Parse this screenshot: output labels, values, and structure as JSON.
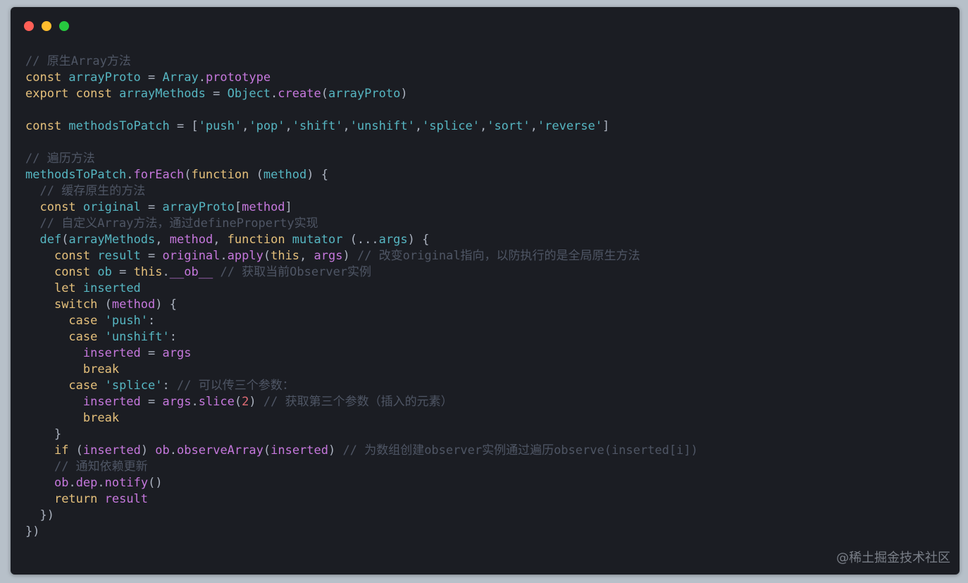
{
  "window": {
    "controls": [
      "close",
      "minimize",
      "maximize"
    ]
  },
  "watermark": "@稀土掘金技术社区",
  "code_lines": [
    [
      {
        "t": "// 原生Array方法",
        "c": "comment"
      }
    ],
    [
      {
        "t": "const ",
        "c": "keyword"
      },
      {
        "t": "arrayProto",
        "c": "var"
      },
      {
        "t": " = ",
        "c": "punct"
      },
      {
        "t": "Array",
        "c": "var"
      },
      {
        "t": ".",
        "c": "punct"
      },
      {
        "t": "prototype",
        "c": "fn"
      }
    ],
    [
      {
        "t": "export ",
        "c": "keyword"
      },
      {
        "t": "const ",
        "c": "keyword"
      },
      {
        "t": "arrayMethods",
        "c": "var"
      },
      {
        "t": " = ",
        "c": "punct"
      },
      {
        "t": "Object",
        "c": "var"
      },
      {
        "t": ".",
        "c": "punct"
      },
      {
        "t": "create",
        "c": "fn"
      },
      {
        "t": "(",
        "c": "punct"
      },
      {
        "t": "arrayProto",
        "c": "var"
      },
      {
        "t": ")",
        "c": "punct"
      }
    ],
    [],
    [
      {
        "t": "const ",
        "c": "keyword"
      },
      {
        "t": "methodsToPatch",
        "c": "var"
      },
      {
        "t": " = [",
        "c": "punct"
      },
      {
        "t": "'push'",
        "c": "string"
      },
      {
        "t": ",",
        "c": "punct"
      },
      {
        "t": "'pop'",
        "c": "string"
      },
      {
        "t": ",",
        "c": "punct"
      },
      {
        "t": "'shift'",
        "c": "string"
      },
      {
        "t": ",",
        "c": "punct"
      },
      {
        "t": "'unshift'",
        "c": "string"
      },
      {
        "t": ",",
        "c": "punct"
      },
      {
        "t": "'splice'",
        "c": "string"
      },
      {
        "t": ",",
        "c": "punct"
      },
      {
        "t": "'sort'",
        "c": "string"
      },
      {
        "t": ",",
        "c": "punct"
      },
      {
        "t": "'reverse'",
        "c": "string"
      },
      {
        "t": "]",
        "c": "punct"
      }
    ],
    [],
    [
      {
        "t": "// 遍历方法",
        "c": "comment"
      }
    ],
    [
      {
        "t": "methodsToPatch",
        "c": "var"
      },
      {
        "t": ".",
        "c": "punct"
      },
      {
        "t": "forEach",
        "c": "fn"
      },
      {
        "t": "(",
        "c": "punct"
      },
      {
        "t": "function ",
        "c": "keyword"
      },
      {
        "t": "(",
        "c": "punct"
      },
      {
        "t": "method",
        "c": "var"
      },
      {
        "t": ") {",
        "c": "punct"
      }
    ],
    [
      {
        "t": "  ",
        "c": "punct"
      },
      {
        "t": "// 缓存原生的方法",
        "c": "comment"
      }
    ],
    [
      {
        "t": "  ",
        "c": "punct"
      },
      {
        "t": "const ",
        "c": "keyword"
      },
      {
        "t": "original",
        "c": "var"
      },
      {
        "t": " = ",
        "c": "punct"
      },
      {
        "t": "arrayProto",
        "c": "var"
      },
      {
        "t": "[",
        "c": "punct"
      },
      {
        "t": "method",
        "c": "param"
      },
      {
        "t": "]",
        "c": "punct"
      }
    ],
    [
      {
        "t": "  ",
        "c": "punct"
      },
      {
        "t": "// 自定义Array方法，通过defineProperty实现",
        "c": "comment"
      }
    ],
    [
      {
        "t": "  ",
        "c": "punct"
      },
      {
        "t": "def",
        "c": "var"
      },
      {
        "t": "(",
        "c": "punct"
      },
      {
        "t": "arrayMethods",
        "c": "var"
      },
      {
        "t": ", ",
        "c": "punct"
      },
      {
        "t": "method",
        "c": "param"
      },
      {
        "t": ", ",
        "c": "punct"
      },
      {
        "t": "function ",
        "c": "keyword"
      },
      {
        "t": "mutator",
        "c": "var"
      },
      {
        "t": " (...",
        "c": "punct"
      },
      {
        "t": "args",
        "c": "var"
      },
      {
        "t": ") {",
        "c": "punct"
      }
    ],
    [
      {
        "t": "    ",
        "c": "punct"
      },
      {
        "t": "const ",
        "c": "keyword"
      },
      {
        "t": "result",
        "c": "var"
      },
      {
        "t": " = ",
        "c": "punct"
      },
      {
        "t": "original",
        "c": "param"
      },
      {
        "t": ".",
        "c": "punct"
      },
      {
        "t": "apply",
        "c": "fn"
      },
      {
        "t": "(",
        "c": "punct"
      },
      {
        "t": "this",
        "c": "keyword"
      },
      {
        "t": ", ",
        "c": "punct"
      },
      {
        "t": "args",
        "c": "param"
      },
      {
        "t": ") ",
        "c": "punct"
      },
      {
        "t": "// 改变original指向，以防执行的是全局原生方法",
        "c": "comment"
      }
    ],
    [
      {
        "t": "    ",
        "c": "punct"
      },
      {
        "t": "const ",
        "c": "keyword"
      },
      {
        "t": "ob",
        "c": "var"
      },
      {
        "t": " = ",
        "c": "punct"
      },
      {
        "t": "this",
        "c": "keyword"
      },
      {
        "t": ".",
        "c": "punct"
      },
      {
        "t": "__ob__",
        "c": "fn"
      },
      {
        "t": " ",
        "c": "punct"
      },
      {
        "t": "// 获取当前Observer实例",
        "c": "comment"
      }
    ],
    [
      {
        "t": "    ",
        "c": "punct"
      },
      {
        "t": "let ",
        "c": "keyword"
      },
      {
        "t": "inserted",
        "c": "var"
      }
    ],
    [
      {
        "t": "    ",
        "c": "punct"
      },
      {
        "t": "switch ",
        "c": "keyword"
      },
      {
        "t": "(",
        "c": "punct"
      },
      {
        "t": "method",
        "c": "param"
      },
      {
        "t": ") {",
        "c": "punct"
      }
    ],
    [
      {
        "t": "      ",
        "c": "punct"
      },
      {
        "t": "case ",
        "c": "keyword"
      },
      {
        "t": "'push'",
        "c": "string"
      },
      {
        "t": ":",
        "c": "punct"
      }
    ],
    [
      {
        "t": "      ",
        "c": "punct"
      },
      {
        "t": "case ",
        "c": "keyword"
      },
      {
        "t": "'unshift'",
        "c": "string"
      },
      {
        "t": ":",
        "c": "punct"
      }
    ],
    [
      {
        "t": "        ",
        "c": "punct"
      },
      {
        "t": "inserted",
        "c": "param"
      },
      {
        "t": " = ",
        "c": "punct"
      },
      {
        "t": "args",
        "c": "param"
      }
    ],
    [
      {
        "t": "        ",
        "c": "punct"
      },
      {
        "t": "break",
        "c": "keyword"
      }
    ],
    [
      {
        "t": "      ",
        "c": "punct"
      },
      {
        "t": "case ",
        "c": "keyword"
      },
      {
        "t": "'splice'",
        "c": "string"
      },
      {
        "t": ": ",
        "c": "punct"
      },
      {
        "t": "// 可以传三个参数：",
        "c": "comment"
      }
    ],
    [
      {
        "t": "        ",
        "c": "punct"
      },
      {
        "t": "inserted",
        "c": "param"
      },
      {
        "t": " = ",
        "c": "punct"
      },
      {
        "t": "args",
        "c": "param"
      },
      {
        "t": ".",
        "c": "punct"
      },
      {
        "t": "slice",
        "c": "fn"
      },
      {
        "t": "(",
        "c": "punct"
      },
      {
        "t": "2",
        "c": "number"
      },
      {
        "t": ") ",
        "c": "punct"
      },
      {
        "t": "// 获取第三个参数（插入的元素）",
        "c": "comment"
      }
    ],
    [
      {
        "t": "        ",
        "c": "punct"
      },
      {
        "t": "break",
        "c": "keyword"
      }
    ],
    [
      {
        "t": "    }",
        "c": "punct"
      }
    ],
    [
      {
        "t": "    ",
        "c": "punct"
      },
      {
        "t": "if ",
        "c": "keyword"
      },
      {
        "t": "(",
        "c": "punct"
      },
      {
        "t": "inserted",
        "c": "param"
      },
      {
        "t": ") ",
        "c": "punct"
      },
      {
        "t": "ob",
        "c": "param"
      },
      {
        "t": ".",
        "c": "punct"
      },
      {
        "t": "observeArray",
        "c": "fn"
      },
      {
        "t": "(",
        "c": "punct"
      },
      {
        "t": "inserted",
        "c": "param"
      },
      {
        "t": ") ",
        "c": "punct"
      },
      {
        "t": "// 为数组创建observer实例通过遍历observe(inserted[i])",
        "c": "comment"
      }
    ],
    [
      {
        "t": "    ",
        "c": "punct"
      },
      {
        "t": "// 通知依赖更新",
        "c": "comment"
      }
    ],
    [
      {
        "t": "    ",
        "c": "punct"
      },
      {
        "t": "ob",
        "c": "param"
      },
      {
        "t": ".",
        "c": "punct"
      },
      {
        "t": "dep",
        "c": "fn"
      },
      {
        "t": ".",
        "c": "punct"
      },
      {
        "t": "notify",
        "c": "fn"
      },
      {
        "t": "()",
        "c": "punct"
      }
    ],
    [
      {
        "t": "    ",
        "c": "punct"
      },
      {
        "t": "return ",
        "c": "keyword"
      },
      {
        "t": "result",
        "c": "param"
      }
    ],
    [
      {
        "t": "  })",
        "c": "punct"
      }
    ],
    [
      {
        "t": "})",
        "c": "punct"
      }
    ]
  ]
}
